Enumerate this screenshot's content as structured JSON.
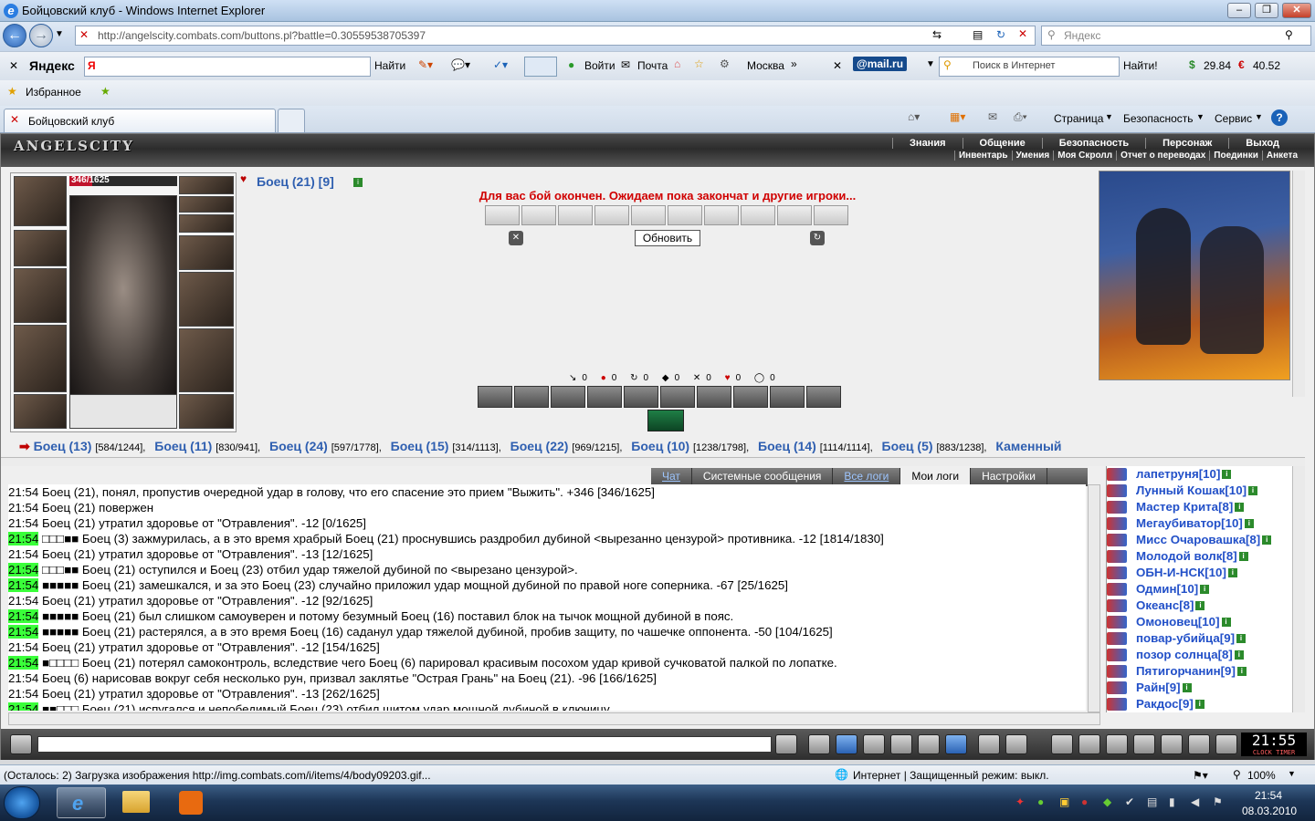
{
  "window": {
    "title": "Бойцовский клуб - Windows Internet Explorer"
  },
  "address": {
    "url": "http://angelscity.combats.com/buttons.pl?battle=0.30559538705397",
    "search_placeholder": "Яндекс"
  },
  "yandex_bar": {
    "brand": "Яндекс",
    "input_value": "Я",
    "find_label": "Найти",
    "login_label": "Войти",
    "mail_label": "Почта",
    "city": "Москва",
    "mailru": "@mail.ru",
    "search_placeholder": "Поиск в Интернет",
    "find2_label": "Найти!",
    "usd": "29.84",
    "eur": "40.52"
  },
  "favorites": {
    "label": "Избранное"
  },
  "tab": {
    "label": "Бойцовский клуб"
  },
  "toolbar": {
    "page_label": "Страница",
    "security_label": "Безопасность",
    "service_label": "Сервис"
  },
  "game": {
    "logo": "ANGELSCITY",
    "menu_top": [
      "Знания",
      "Общение",
      "Безопасность",
      "Персонаж",
      "Выход"
    ],
    "menu_bottom": [
      "Инвентарь",
      "Умения",
      "Моя Скролл",
      "Отчет о переводах",
      "Поединки",
      "Анкета"
    ],
    "hp_current": "346",
    "hp_max": "/1625",
    "hp_fraction": 0.213,
    "player_name": "Боец (21) [9]",
    "battle_message": "Для вас бой окончен. Ожидаем пока закончат и другие игроки...",
    "refresh_label": "Обновить",
    "stats": [
      "0",
      "0",
      "0",
      "0",
      "0",
      "0",
      "0"
    ],
    "opponents": [
      {
        "name": "Боец (13)",
        "hp": "[584/1244],"
      },
      {
        "name": "Боец (11)",
        "hp": "[830/941],"
      },
      {
        "name": "Боец (24)",
        "hp": "[597/1778],"
      },
      {
        "name": "Боец (15)",
        "hp": "[314/1113],"
      },
      {
        "name": "Боец (22)",
        "hp": "[969/1215],"
      },
      {
        "name": "Боец (10)",
        "hp": "[1238/1798],"
      },
      {
        "name": "Боец (14)",
        "hp": "[1114/1114],"
      },
      {
        "name": "Боец (5)",
        "hp": "[883/1238],"
      },
      {
        "name": "Каменный",
        "hp": ""
      }
    ],
    "log_tabs": [
      "Чат",
      "Системные сообщения",
      "Все логи",
      "Мои логи",
      "Настройки"
    ],
    "log": [
      {
        "time": "21:54",
        "hl": false,
        "text": "Боец (21), понял, пропустив очередной удар в голову, что его спасение это прием \"Выжить\". +346 [346/1625]"
      },
      {
        "time": "21:54",
        "hl": false,
        "text": "Боец (21) повержен"
      },
      {
        "time": "21:54",
        "hl": false,
        "text": "Боец (21) утратил здоровье от \"Отравления\". -12 [0/1625]"
      },
      {
        "time": "21:54",
        "hl": true,
        "text": "□□□■■ Боец (3) зажмурилась, а в это время храбрый Боец (21) проснувшись раздробил дубиной <вырезанно цензурой> противника. -12 [1814/1830]"
      },
      {
        "time": "21:54",
        "hl": false,
        "text": "Боец (21) утратил здоровье от \"Отравления\". -13 [12/1625]"
      },
      {
        "time": "21:54",
        "hl": true,
        "text": "□□□■■ Боец (21) оступился и Боец (23) отбил удар тяжелой дубиной по <вырезано цензурой>."
      },
      {
        "time": "21:54",
        "hl": true,
        "text": "■■■■■ Боец (21) замешкался, и за это Боец (23) случайно приложил удар мощной дубиной по правой ноге соперника. -67 [25/1625]"
      },
      {
        "time": "21:54",
        "hl": false,
        "text": "Боец (21) утратил здоровье от \"Отравления\". -12 [92/1625]"
      },
      {
        "time": "21:54",
        "hl": true,
        "text": "■■■■■ Боец (21) был слишком самоуверен и потому безумный Боец (16) поставил блок на тычок мощной дубиной в пояс."
      },
      {
        "time": "21:54",
        "hl": true,
        "text": "■■■■■ Боец (21) растерялся, а в это время Боец (16) саданул удар тяжелой дубиной, пробив защиту, по чашечке оппонента. -50 [104/1625]"
      },
      {
        "time": "21:54",
        "hl": false,
        "text": "Боец (21) утратил здоровье от \"Отравления\". -12 [154/1625]"
      },
      {
        "time": "21:54",
        "hl": true,
        "text": "■□□□□ Боец (21) потерял самоконтроль, вследствие чего Боец (6) парировал красивым посохом удар кривой сучковатой палкой по лопатке."
      },
      {
        "time": "21:54",
        "hl": false,
        "text": "Боец (6) нарисовав вокруг себя несколько рун, призвал заклятье \"Острая Грань\" на Боец (21). -96 [166/1625]"
      },
      {
        "time": "21:54",
        "hl": false,
        "text": "Боец (21) утратил здоровье от \"Отравления\". -13 [262/1625]"
      },
      {
        "time": "21:54",
        "hl": true,
        "text": "■■□□□ Боец (21) испугался и непобедимый Боец (23) отбил щитом удар мощной дубиной в ключицу."
      }
    ],
    "players": [
      "лапетруня[10]",
      "Лунный Кошак[10]",
      "Мастер Крита[8]",
      "Мегаубиватор[10]",
      "Мисс Очаровашка[8]",
      "Молодой волк[8]",
      "ОБН-И-НСК[10]",
      "Одмин[10]",
      "Океанс[8]",
      "Омоновец[10]",
      "повар-убийца[9]",
      "позор солнца[8]",
      "Пятигорчанин[9]",
      "Райн[9]",
      "Ракдос[9]"
    ],
    "clock": "21:55",
    "clock_label": "CLOCK TIMER"
  },
  "statusbar": {
    "text": "(Осталось: 2) Загрузка изображения http://img.combats.com/i/items/4/body09203.gif...",
    "zone": "Интернет | Защищенный режим: выкл.",
    "zoom": "100%"
  },
  "taskbar": {
    "time": "21:54",
    "date": "08.03.2010"
  }
}
